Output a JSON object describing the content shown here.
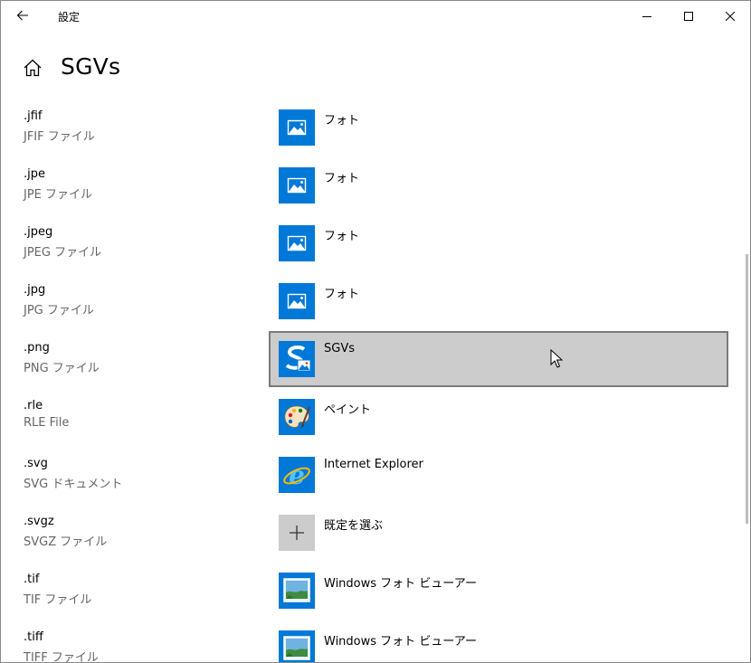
{
  "window": {
    "title": "設定"
  },
  "header": {
    "title": "SGVs"
  },
  "colors": {
    "accent": "#0078d7",
    "selected_bg": "#cccccc",
    "muted_text": "#666666"
  },
  "rows": [
    {
      "ext": ".jfif",
      "desc": "JFIF ファイル",
      "app": "フォト",
      "icon": "photos-icon"
    },
    {
      "ext": ".jpe",
      "desc": "JPE ファイル",
      "app": "フォト",
      "icon": "photos-icon"
    },
    {
      "ext": ".jpeg",
      "desc": "JPEG ファイル",
      "app": "フォト",
      "icon": "photos-icon"
    },
    {
      "ext": ".jpg",
      "desc": "JPG ファイル",
      "app": "フォト",
      "icon": "photos-icon"
    },
    {
      "ext": ".png",
      "desc": "PNG ファイル",
      "app": "SGVs",
      "icon": "sgvs-app-icon",
      "selected": true
    },
    {
      "ext": ".rle",
      "desc": "RLE File",
      "app": "ペイント",
      "icon": "paint-palette-icon"
    },
    {
      "ext": ".svg",
      "desc": "SVG ドキュメント",
      "app": "Internet Explorer",
      "icon": "internet-explorer-icon"
    },
    {
      "ext": ".svgz",
      "desc": "SVGZ ファイル",
      "app": "既定を選ぶ",
      "icon": "plus-icon"
    },
    {
      "ext": ".tif",
      "desc": "TIF ファイル",
      "app": "Windows フォト ビューアー",
      "icon": "photo-viewer-icon"
    },
    {
      "ext": ".tiff",
      "desc": "TIFF ファイル",
      "app": "Windows フォト ビューアー",
      "icon": "photo-viewer-icon"
    }
  ]
}
